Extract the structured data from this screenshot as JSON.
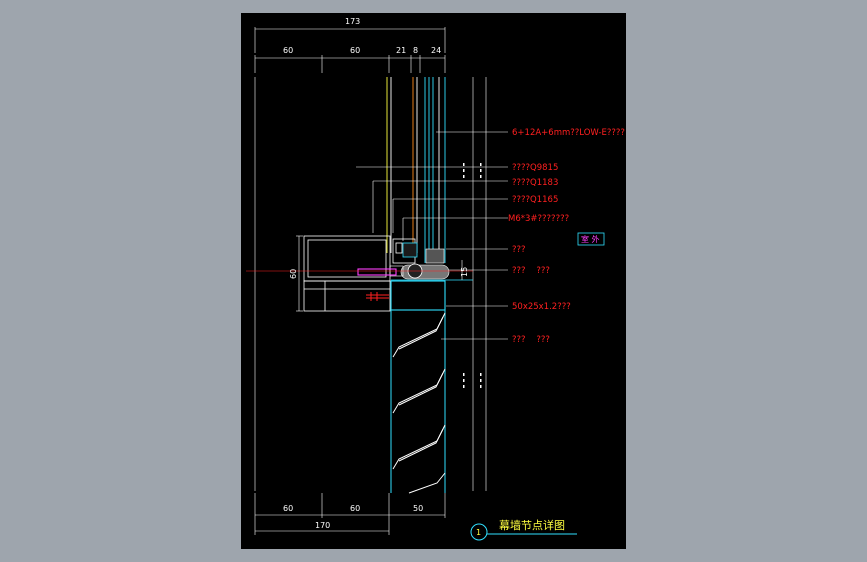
{
  "dimensions": {
    "top_total": "173",
    "top_60a": "60",
    "top_60b": "60",
    "top_21": "21",
    "top_8": "8",
    "top_24": "24",
    "bottom_60a": "60",
    "bottom_60b": "60",
    "bottom_50": "50",
    "bottom_total": "170",
    "side_15": "15",
    "side_60": "60"
  },
  "callouts": [
    "6+12A+6mm??LOW-E????",
    "????Q9815",
    "????Q1183",
    "????Q1165",
    "M6*3#???????",
    "???",
    "???    ???",
    "50x25x1.2???",
    "???    ???"
  ],
  "side_tag": "室 外",
  "title": {
    "number": "1",
    "text": "幕墙节点详图"
  },
  "colors": {
    "background": "#9ea5ad",
    "sheet": "#000000",
    "leader": "#ffffff",
    "label": "#ff2020",
    "cyan": "#30e0ff",
    "yellow": "#ffff40",
    "magenta": "#ff40ff"
  }
}
